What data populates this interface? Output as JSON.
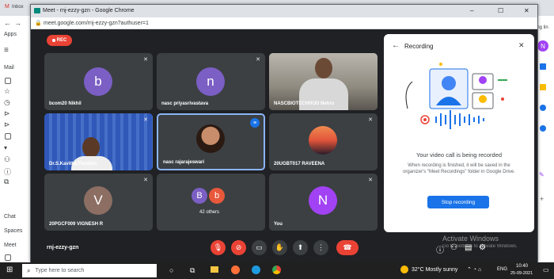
{
  "background": {
    "tab_label": "Inbox",
    "sidebar_labels": [
      "Mail",
      "Chat",
      "Spaces",
      "Meet"
    ],
    "apps_label": "Apps",
    "right_label": "ating lin",
    "avatar_letter": "N"
  },
  "window": {
    "title": "Meet - rnj-ezzy-gzn - Google Chrome",
    "url": "meet.google.com/rnj-ezzy-gzn?authuser=1",
    "minimize": "–",
    "maximize": "☐",
    "close": "✕"
  },
  "rec_badge": "REC",
  "tiles": [
    {
      "name": "bcom20 Nikhil",
      "initial": "b",
      "color": "#7b5fc4"
    },
    {
      "name": "nasc priyasrivastava",
      "initial": "n",
      "color": "#7b5fc4"
    },
    {
      "name": "NASCBIOTECHHOD Nehru",
      "initial": "",
      "color": ""
    },
    {
      "name": "Dr.S.Kavitha Pandian",
      "initial": "",
      "color": ""
    },
    {
      "name": "nasc rajarajeswari",
      "initial": "",
      "color": ""
    },
    {
      "name": "20UGBT017 RAVEENA",
      "initial": "",
      "color": ""
    },
    {
      "name": "20PGCF009 VIGNESH R",
      "initial": "V",
      "color": "#8d6e63"
    },
    {
      "name": "42 others",
      "initial": "",
      "color": ""
    },
    {
      "name": "You",
      "initial": "N",
      "color": "#a142f4"
    }
  ],
  "others_avatars": [
    {
      "letter": "B",
      "color": "#7b5fc4"
    },
    {
      "letter": "b",
      "color": "#e8583b"
    }
  ],
  "panel": {
    "title": "Recording",
    "heading": "Your video call is being recorded",
    "body": "When recording is finished, it will be saved in the organizer's \"Meet Recordings\" folder in Google Drive.",
    "button": "Stop recording"
  },
  "meeting_code": "rnj-ezzy-gzn",
  "watermark": {
    "line1": "Activate Windows",
    "line2": "Go to Settings to activate Windows."
  },
  "taskbar": {
    "search": "Type here to search",
    "weather": "32°C  Mostly sunny",
    "lang": "ENG",
    "time": "10:40",
    "date": "25-09-2021"
  }
}
